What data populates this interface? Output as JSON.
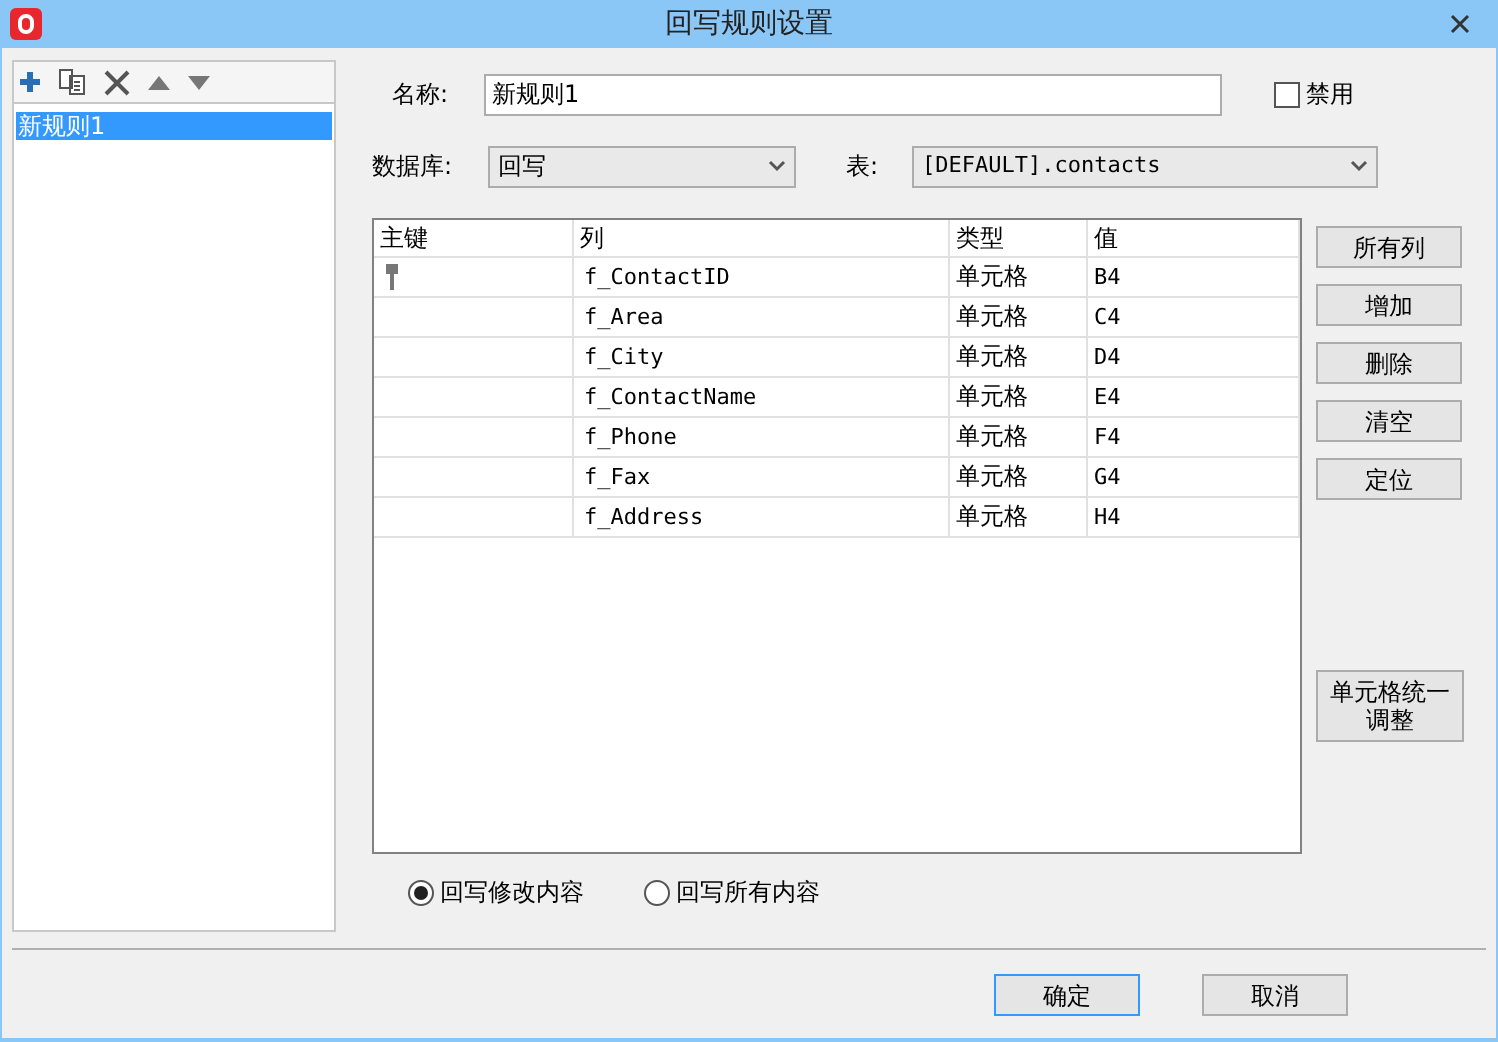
{
  "window": {
    "title": "回写规则设置"
  },
  "rules": [
    {
      "label": "新规则1",
      "selected": true
    }
  ],
  "name": {
    "label": "名称:",
    "value": "新规则1"
  },
  "disable": {
    "label": "禁用",
    "checked": false
  },
  "database": {
    "label": "数据库:",
    "value": "回写"
  },
  "table_select": {
    "label": "表:",
    "value": "[DEFAULT].contacts"
  },
  "table": {
    "columns": [
      "主键",
      "列",
      "类型",
      "值"
    ],
    "rows": [
      {
        "primary_key": true,
        "column": "f_ContactID",
        "type": "单元格",
        "value": "B4"
      },
      {
        "primary_key": false,
        "column": "f_Area",
        "type": "单元格",
        "value": "C4"
      },
      {
        "primary_key": false,
        "column": "f_City",
        "type": "单元格",
        "value": "D4"
      },
      {
        "primary_key": false,
        "column": "f_ContactName",
        "type": "单元格",
        "value": "E4"
      },
      {
        "primary_key": false,
        "column": "f_Phone",
        "type": "单元格",
        "value": "F4"
      },
      {
        "primary_key": false,
        "column": "f_Fax",
        "type": "单元格",
        "value": "G4"
      },
      {
        "primary_key": false,
        "column": "f_Address",
        "type": "单元格",
        "value": "H4"
      }
    ]
  },
  "side_buttons": [
    "所有列",
    "增加",
    "删除",
    "清空",
    "定位"
  ],
  "adjust_button": "单元格统一调整",
  "modes": [
    {
      "label": "回写修改内容",
      "selected": true
    },
    {
      "label": "回写所有内容",
      "selected": false
    }
  ],
  "buttons": [
    {
      "label": "确定",
      "default": true
    },
    {
      "label": "取消",
      "default": false
    }
  ]
}
